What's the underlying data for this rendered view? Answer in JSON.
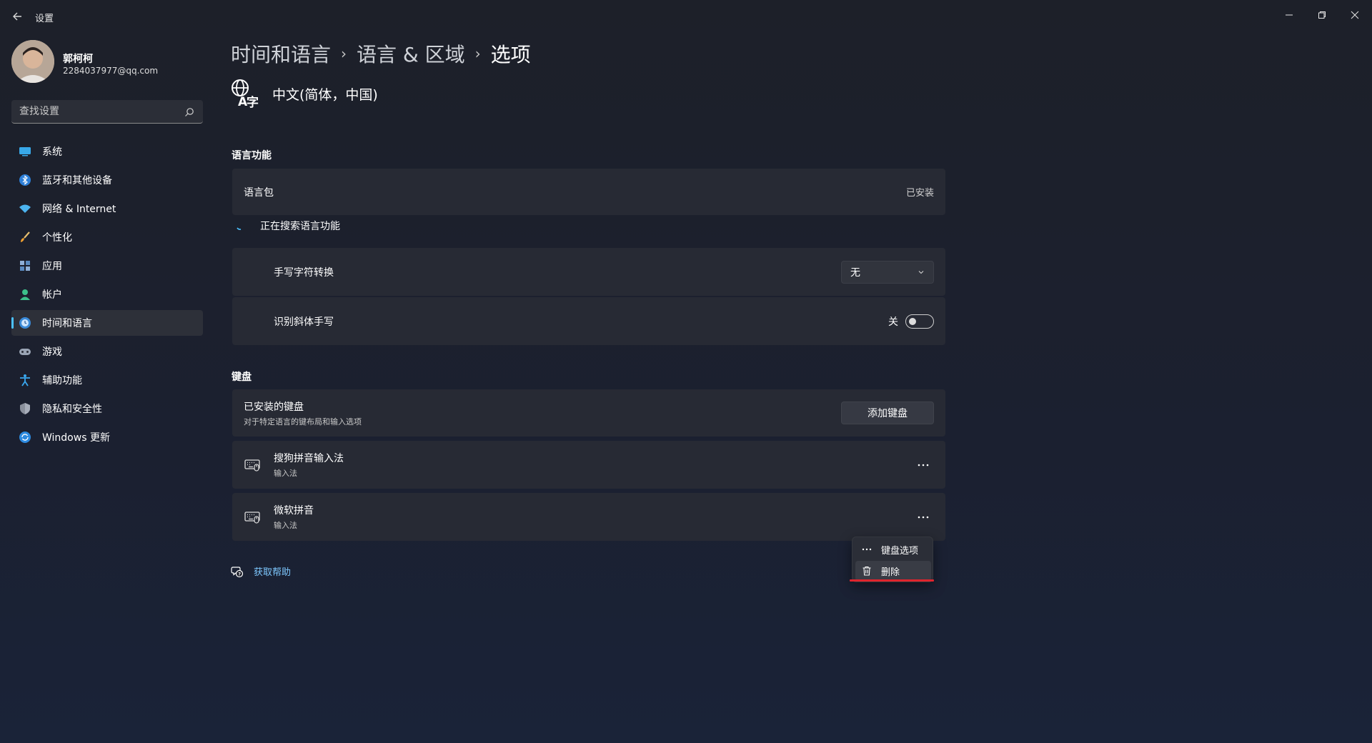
{
  "app": {
    "title": "设置"
  },
  "profile": {
    "name": "郭柯柯",
    "email": "2284037977@qq.com"
  },
  "search": {
    "placeholder": "查找设置"
  },
  "sidebar": {
    "items": [
      {
        "label": "系统",
        "icon": "system-icon"
      },
      {
        "label": "蓝牙和其他设备",
        "icon": "bluetooth-icon"
      },
      {
        "label": "网络 & Internet",
        "icon": "wifi-icon"
      },
      {
        "label": "个性化",
        "icon": "brush-icon"
      },
      {
        "label": "应用",
        "icon": "apps-icon"
      },
      {
        "label": "帐户",
        "icon": "account-icon"
      },
      {
        "label": "时间和语言",
        "icon": "time-language-icon",
        "active": true
      },
      {
        "label": "游戏",
        "icon": "gaming-icon"
      },
      {
        "label": "辅助功能",
        "icon": "accessibility-icon"
      },
      {
        "label": "隐私和安全性",
        "icon": "shield-icon"
      },
      {
        "label": "Windows 更新",
        "icon": "update-icon"
      }
    ]
  },
  "breadcrumb": {
    "level1": "时间和语言",
    "level2": "语言 & 区域",
    "level3": "选项",
    "separator": "›"
  },
  "language": {
    "name": "中文(简体，中国)"
  },
  "language_features": {
    "title": "语言功能",
    "pack_label": "语言包",
    "pack_status": "已安装",
    "searching_text": "正在搜索语言功能",
    "handwriting_label": "手写字符转换",
    "handwriting_value": "无",
    "cursive_label": "识别斜体手写",
    "cursive_state": "关"
  },
  "keyboard": {
    "title": "键盘",
    "installed_label": "已安装的键盘",
    "installed_sub": "对于特定语言的键布局和输入选项",
    "add_button": "添加键盘",
    "items": [
      {
        "name": "搜狗拼音输入法",
        "type": "输入法"
      },
      {
        "name": "微软拼音",
        "type": "输入法"
      }
    ]
  },
  "context_menu": {
    "options": "键盘选项",
    "delete": "删除"
  },
  "help": {
    "label": "获取帮助"
  },
  "colors": {
    "accent": "#4cc2ff",
    "link": "#7ec8ff",
    "highlight_underline": "#e0242d"
  }
}
